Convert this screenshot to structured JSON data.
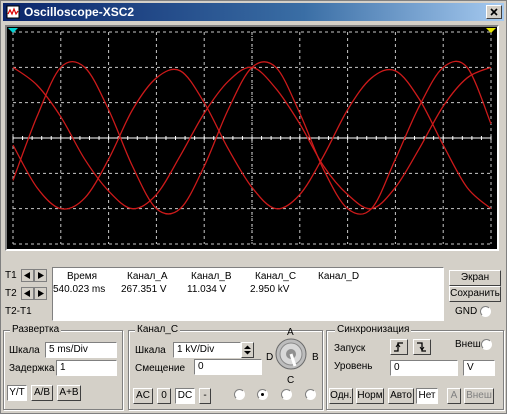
{
  "window": {
    "title": "Oscilloscope-XSC2"
  },
  "colors": {
    "trace": "#cc1a1a",
    "grid": "#c8c8c8",
    "screen_bg": "#000000",
    "titlebar": "#0a246a"
  },
  "icons": {
    "app": "oscilloscope-icon",
    "close": "close-icon",
    "spin_up": "arrow-up-icon",
    "spin_down": "arrow-down-icon"
  },
  "cursors": {
    "t1": "T1",
    "t2": "T2",
    "t2t1": "T2-T1"
  },
  "readout": {
    "headers": [
      "Время",
      "Канал_A",
      "Канал_B",
      "Канал_C",
      "Канал_D"
    ],
    "values": [
      "540.023 ms",
      "267.351 V",
      "11.034 V",
      "2.950 kV",
      ""
    ]
  },
  "side_buttons": {
    "reverse": "Экран",
    "save": "Сохранить",
    "gnd": "GND"
  },
  "timebase": {
    "title": "Развертка",
    "scale_label": "Шкала",
    "scale_value": "5 ms/Div",
    "delay_label": "Задержка",
    "delay_value": "1",
    "modes": [
      "Y/T",
      "A/B",
      "A+B"
    ]
  },
  "channel": {
    "title": "Канал_C",
    "scale_label": "Шкала",
    "scale_value": "1 kV/Div",
    "offset_label": "Смещение",
    "offset_value": "0",
    "coupling": [
      "AC",
      "0",
      "DC",
      "-"
    ],
    "knob_labels": {
      "a": "A",
      "b": "B",
      "c": "C",
      "d": "D"
    }
  },
  "trigger": {
    "title": "Синхронизация",
    "edge_label": "Запуск",
    "ext_label": "Внеш",
    "level_label": "Уровень",
    "level_value": "0",
    "level_unit": "V",
    "modes": [
      "Одн.",
      "Норм",
      "Авто",
      "Нет"
    ],
    "sources": [
      "A",
      "Внеш"
    ]
  },
  "chart_data": {
    "type": "line",
    "x_divisions": 10,
    "y_divisions": 6,
    "x_range": [
      0,
      10
    ],
    "y_range": [
      -3,
      3
    ],
    "grid": true,
    "series": [
      {
        "values": [
          [
            0,
            -1.2
          ],
          [
            0.5,
            0.6
          ],
          [
            1,
            2.0
          ],
          [
            1.5,
            2.0
          ],
          [
            2,
            0.8
          ],
          [
            2.5,
            -0.8
          ],
          [
            3,
            -2.0
          ],
          [
            3.5,
            -2.0
          ],
          [
            4,
            -0.8
          ],
          [
            4.5,
            0.8
          ],
          [
            5,
            2.0
          ],
          [
            5.5,
            2.0
          ],
          [
            6,
            0.7
          ],
          [
            6.5,
            -0.9
          ],
          [
            7,
            -2.0
          ],
          [
            7.5,
            -2.0
          ],
          [
            8,
            -0.6
          ],
          [
            8.5,
            0.9
          ],
          [
            9,
            2.0
          ],
          [
            9.5,
            2.0
          ],
          [
            10,
            0.4
          ]
        ]
      },
      {
        "values": [
          [
            0,
            2.0
          ],
          [
            0.5,
            1.5
          ],
          [
            1,
            0.6
          ],
          [
            1.5,
            -0.6
          ],
          [
            2,
            -1.5
          ],
          [
            2.5,
            -2.0
          ],
          [
            3,
            -1.6
          ],
          [
            3.5,
            -0.5
          ],
          [
            4,
            0.7
          ],
          [
            4.5,
            1.6
          ],
          [
            5,
            2.0
          ],
          [
            5.5,
            1.4
          ],
          [
            6,
            0.4
          ],
          [
            6.5,
            -0.8
          ],
          [
            7,
            -1.6
          ],
          [
            7.5,
            -2.0
          ],
          [
            8,
            -1.4
          ],
          [
            8.5,
            -0.3
          ],
          [
            9,
            0.9
          ],
          [
            9.5,
            1.7
          ],
          [
            10,
            2.0
          ]
        ]
      },
      {
        "values": [
          [
            0,
            -0.2
          ],
          [
            0.5,
            -1.4
          ],
          [
            1,
            -2.0
          ],
          [
            1.5,
            -1.7
          ],
          [
            2,
            -0.6
          ],
          [
            2.5,
            0.8
          ],
          [
            3,
            1.7
          ],
          [
            3.5,
            1.9
          ],
          [
            4,
            1.0
          ],
          [
            4.5,
            -0.3
          ],
          [
            5,
            -1.4
          ],
          [
            5.5,
            -2.0
          ],
          [
            6,
            -1.6
          ],
          [
            6.5,
            -0.5
          ],
          [
            7,
            0.8
          ],
          [
            7.5,
            1.7
          ],
          [
            8,
            1.9
          ],
          [
            8.5,
            1.1
          ],
          [
            9,
            -0.2
          ],
          [
            9.5,
            -1.4
          ],
          [
            10,
            -2.0
          ]
        ]
      }
    ]
  }
}
